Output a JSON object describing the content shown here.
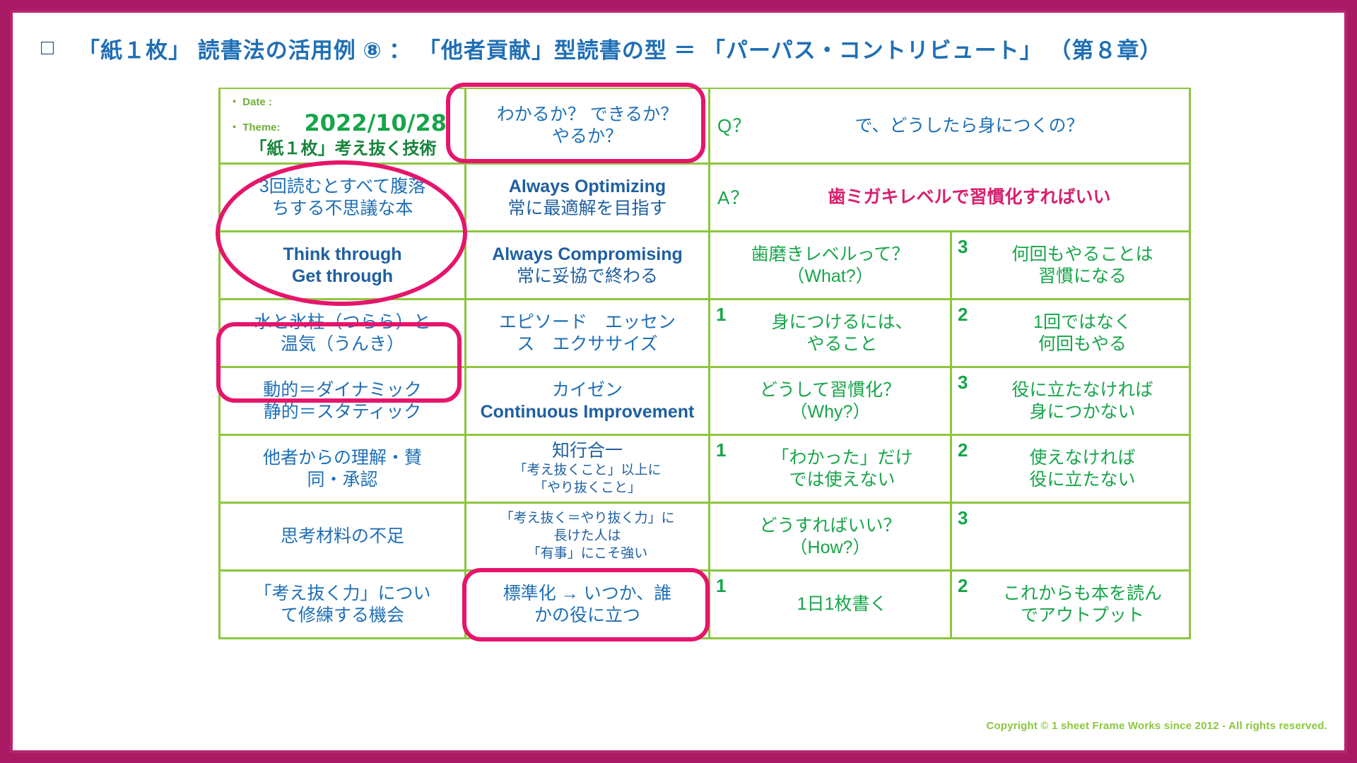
{
  "slide": {
    "title_marker": "□",
    "title": "「紙１枚」 読書法の活用例 ⑧ ： 「他者貢献」型読書の型 ＝ 「パーパス・コントリビュート」 （第８章）",
    "footer_copyright": "Copyright © 1 sheet Frame Works since 2012 - All rights reserved.",
    "colors": {
      "border_magenta": "#a81a64",
      "inner_border": "#b8246e",
      "grid_green": "#8cc63e",
      "text_blue": "#1f6fb5",
      "text_navy": "#1f5fa0",
      "text_green": "#17a54a",
      "highlight_pink": "#e6156c",
      "answer_pink": "#d6206e",
      "footer_green": "#8cc63e"
    }
  },
  "header": {
    "date_label": "・ Date :",
    "date_value": "2022/10/28",
    "theme_label": "・ Theme:",
    "theme_value": "「紙１枚」考え抜く技術"
  },
  "grid": {
    "rows": [
      {
        "c1": {
          "type": "header"
        },
        "c2": {
          "lines": [
            "わかるか？ できるか？",
            "やるか？"
          ],
          "style": "blue"
        },
        "c3": {
          "tag": "Q？",
          "lines": [
            ""
          ],
          "style": "green"
        },
        "c4": {
          "lines": [
            "で、どうしたら身につくの？"
          ],
          "style": "blue",
          "span": true
        }
      },
      {
        "c1": {
          "lines": [
            "3回読むとすべて腹落",
            "ちする不思議な本"
          ],
          "style": "blue"
        },
        "c2": {
          "lines": [
            "Always Optimizing",
            "常に最適解を目指す"
          ],
          "style": "navy"
        },
        "c3": {
          "tag": "A？",
          "lines": [
            ""
          ],
          "style": "green"
        },
        "c4": {
          "lines": [
            "歯ミガキレベルで習慣化すればいい"
          ],
          "style": "pink",
          "span": true
        }
      },
      {
        "c1": {
          "lines": [
            "Think through",
            "Get through"
          ],
          "style": "navy"
        },
        "c2": {
          "lines": [
            "Always Compromising",
            "常に妥協で終わる"
          ],
          "style": "navy"
        },
        "c3": {
          "lines": [
            "歯磨きレベルって？",
            "（What?）"
          ],
          "style": "green"
        },
        "c4": {
          "num": "3",
          "lines": [
            "何回もやることは",
            "習慣になる"
          ],
          "style": "green"
        }
      },
      {
        "c1": {
          "lines": [
            "水と氷柱（つらら）と",
            "温気（うんき）"
          ],
          "style": "blue"
        },
        "c2": {
          "lines": [
            "エピソード　エッセン",
            "ス　エクササイズ"
          ],
          "style": "blue"
        },
        "c3": {
          "num": "1",
          "lines": [
            "身につけるには、",
            "やること"
          ],
          "style": "green"
        },
        "c4": {
          "num": "2",
          "lines": [
            "1回ではなく",
            "何回もやる"
          ],
          "style": "green"
        }
      },
      {
        "c1": {
          "lines": [
            "動的＝ダイナミック",
            "静的＝スタティック"
          ],
          "style": "blue"
        },
        "c2": {
          "lines": [
            "カイゼン",
            "Continuous Improvement"
          ],
          "style": "navy"
        },
        "c3": {
          "lines": [
            "どうして習慣化？",
            "（Why?）"
          ],
          "style": "green"
        },
        "c4": {
          "num": "3",
          "lines": [
            "役に立たなければ",
            "身につかない"
          ],
          "style": "green"
        }
      },
      {
        "c1": {
          "lines": [
            "他者からの理解・賛",
            "同・承認"
          ],
          "style": "blue"
        },
        "c2": {
          "lines": [
            "知行合一"
          ],
          "sublines": [
            "「考え抜くこと」以上に",
            "「やり抜くこと」"
          ],
          "style": "navy"
        },
        "c3": {
          "num": "1",
          "lines": [
            "「わかった」だけ",
            "では使えない"
          ],
          "style": "green"
        },
        "c4": {
          "num": "2",
          "lines": [
            "使えなければ",
            "役に立たない"
          ],
          "style": "green"
        }
      },
      {
        "c1": {
          "lines": [
            "思考材料の不足"
          ],
          "style": "blue"
        },
        "c2": {
          "sublines": [
            "「考え抜く＝やり抜く力」に",
            "長けた人は",
            "「有事」にこそ強い"
          ],
          "style": "navy"
        },
        "c3": {
          "lines": [
            "どうすればいい？",
            "（How?）"
          ],
          "style": "green"
        },
        "c4": {
          "num": "3",
          "lines": [
            ""
          ],
          "style": "green"
        }
      },
      {
        "c1": {
          "lines": [
            "「考え抜く力」につい",
            "て修練する機会"
          ],
          "style": "blue"
        },
        "c2": {
          "lines": [
            "標準化 → いつか、誰",
            "かの役に立つ"
          ],
          "style": "blue"
        },
        "c3": {
          "num": "1",
          "lines": [
            "1日1枚書く"
          ],
          "style": "green"
        },
        "c4": {
          "num": "2",
          "lines": [
            "これからも本を読ん",
            "でアウトプット"
          ],
          "style": "green"
        }
      }
    ]
  },
  "annotations": [
    {
      "name": "highlight-wakaruka-cell",
      "shape": "rounded-rect"
    },
    {
      "name": "highlight-3kai-think-ellipse",
      "shape": "ellipse"
    },
    {
      "name": "highlight-mizu-koori-cell",
      "shape": "rounded-rect"
    },
    {
      "name": "highlight-kangaenuku-yarinuku-cell",
      "shape": "rounded-rect"
    }
  ]
}
